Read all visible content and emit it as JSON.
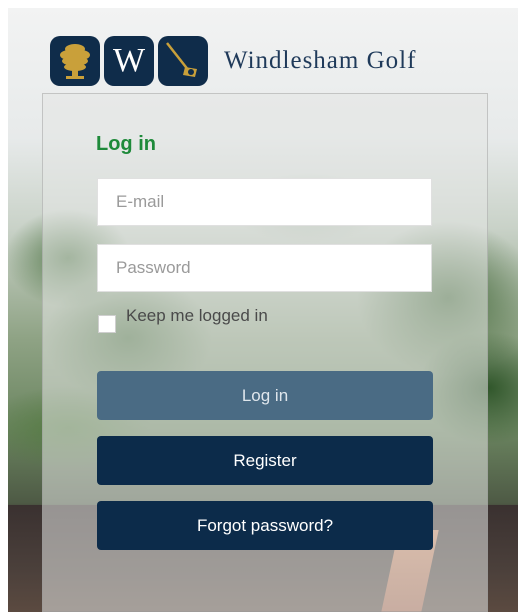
{
  "brand": {
    "name": "Windlesham Golf",
    "monogram": "W",
    "icons": [
      "tree-icon",
      "w-monogram-icon",
      "golf-club-ball-icon"
    ],
    "colors": {
      "navy": "#0f2c4a",
      "gold": "#c9a03a"
    }
  },
  "login": {
    "title": "Log in",
    "title_color": "#1e8a3a",
    "email_placeholder": "E-mail",
    "email_value": "",
    "password_placeholder": "Password",
    "password_value": "",
    "keep_logged_in_label": "Keep me logged in",
    "keep_logged_in_checked": false,
    "login_button": "Log in",
    "register_button": "Register",
    "forgot_button": "Forgot password?"
  }
}
